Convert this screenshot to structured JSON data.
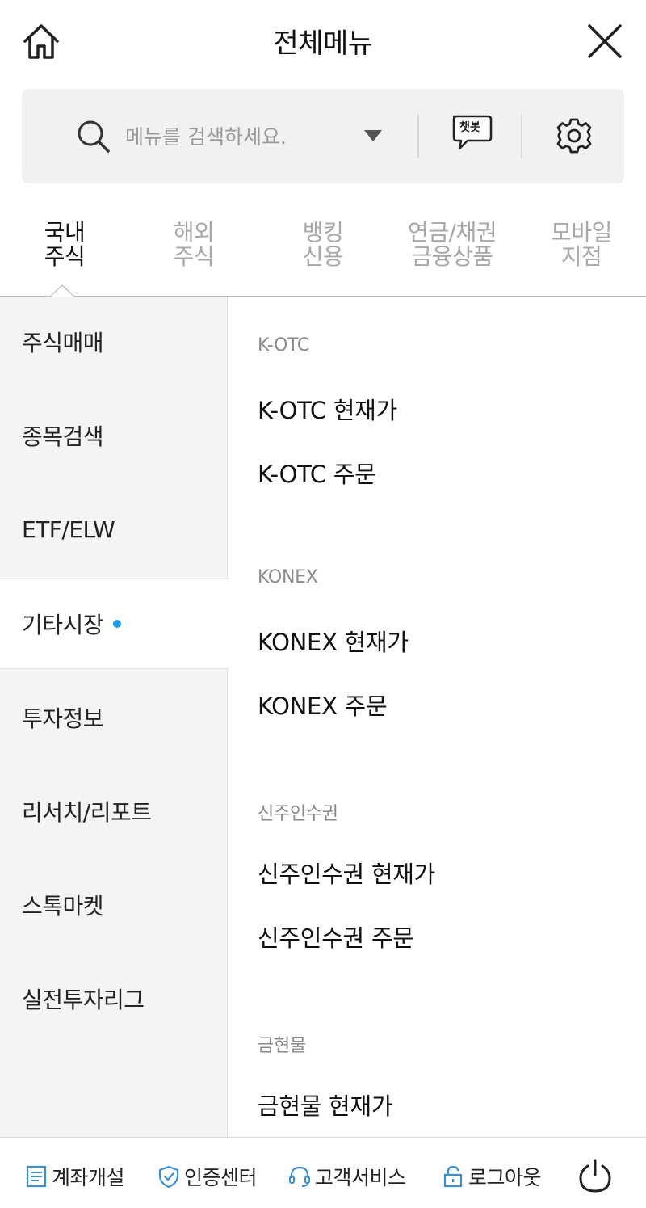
{
  "header": {
    "title": "전체메뉴"
  },
  "search": {
    "placeholder": "메뉴를 검색하세요.",
    "chatbot_label": "챗봇"
  },
  "tabs": [
    {
      "label": "국내\n주식",
      "active": true
    },
    {
      "label": "해외\n주식",
      "active": false
    },
    {
      "label": "뱅킹\n신용",
      "active": false
    },
    {
      "label": "연금/채권\n금융상품",
      "active": false
    },
    {
      "label": "모바일\n지점",
      "active": false
    }
  ],
  "left_menu": [
    {
      "label": "주식매매"
    },
    {
      "label": "종목검색"
    },
    {
      "label": "ETF/ELW"
    },
    {
      "label": "기타시장",
      "active": true
    },
    {
      "label": "투자정보"
    },
    {
      "label": "리서치/리포트"
    },
    {
      "label": "스톡마켓"
    },
    {
      "label": "실전투자리그"
    }
  ],
  "sections": [
    {
      "header": "K-OTC",
      "items": [
        "K-OTC 현재가",
        "K-OTC 주문"
      ]
    },
    {
      "header": "KONEX",
      "items": [
        "KONEX 현재가",
        "KONEX 주문"
      ]
    },
    {
      "header": "신주인수권",
      "items": [
        "신주인수권 현재가",
        "신주인수권 주문"
      ]
    },
    {
      "header": "금현물",
      "items": [
        "금현물 현재가"
      ]
    }
  ],
  "bottom_bar": {
    "account_open": "계좌개설",
    "cert_center": "인증센터",
    "customer_service": "고객서비스",
    "logout": "로그아웃"
  },
  "colors": {
    "accent_dot": "#1a9cf0",
    "icon_blue": "#3a8fd6"
  }
}
